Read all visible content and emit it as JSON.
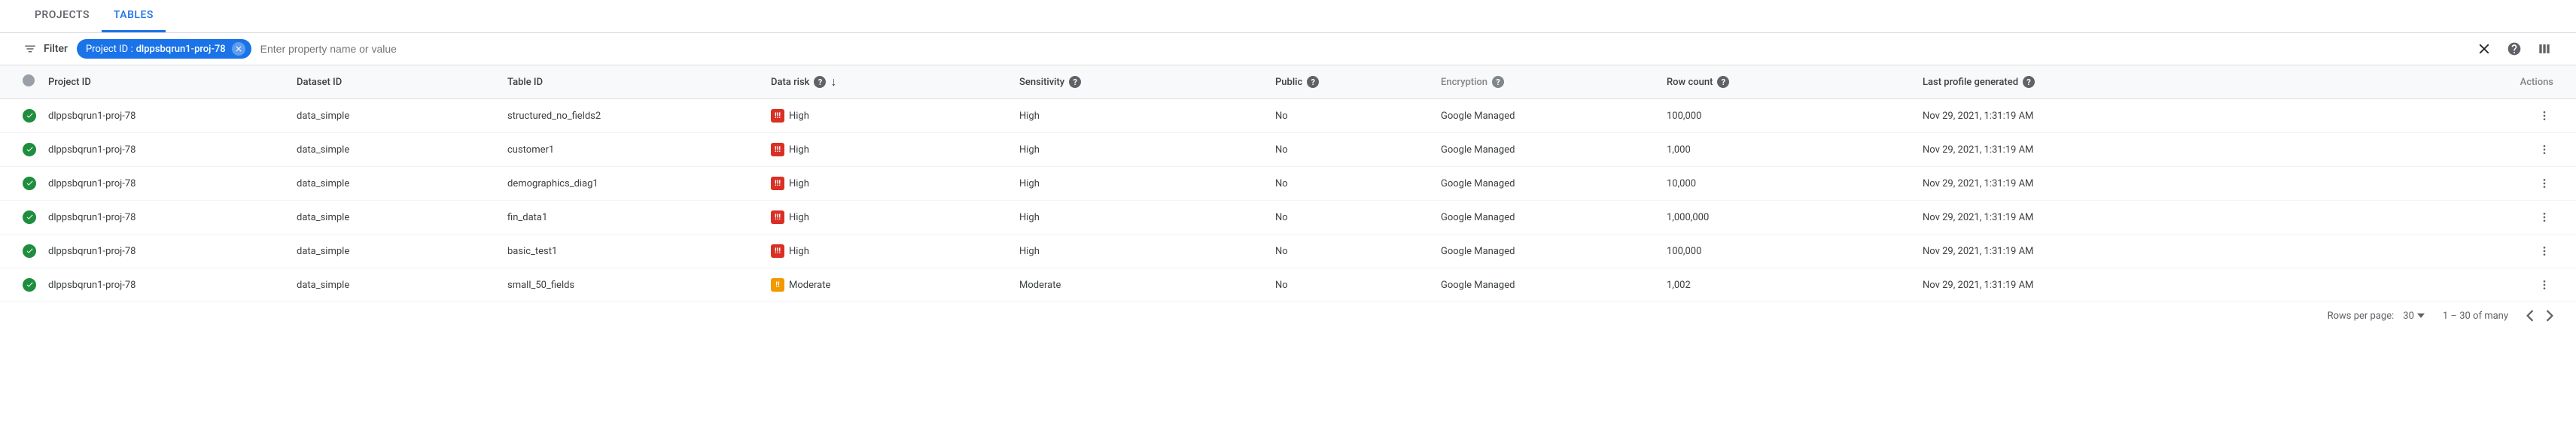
{
  "tabs": [
    {
      "label": "PROJECTS",
      "active": false
    },
    {
      "label": "TABLES",
      "active": true
    }
  ],
  "filter": {
    "label": "Filter",
    "chip_key": "Project ID :",
    "chip_value": "dlppsbqrun1-proj-78",
    "placeholder": "Enter property name or value"
  },
  "columns": {
    "project_id": "Project ID",
    "dataset_id": "Dataset ID",
    "table_id": "Table ID",
    "data_risk": "Data risk",
    "sensitivity": "Sensitivity",
    "public": "Public",
    "encryption": "Encryption",
    "row_count": "Row count",
    "last_generated": "Last profile generated",
    "actions": "Actions"
  },
  "rows": [
    {
      "project_id": "dlppsbqrun1-proj-78",
      "dataset_id": "data_simple",
      "table_id": "structured_no_fields2",
      "data_risk": "High",
      "risk_level": "high",
      "sensitivity": "High",
      "public": "No",
      "encryption": "Google Managed",
      "row_count": "100,000",
      "last_generated": "Nov 29, 2021, 1:31:19 AM"
    },
    {
      "project_id": "dlppsbqrun1-proj-78",
      "dataset_id": "data_simple",
      "table_id": "customer1",
      "data_risk": "High",
      "risk_level": "high",
      "sensitivity": "High",
      "public": "No",
      "encryption": "Google Managed",
      "row_count": "1,000",
      "last_generated": "Nov 29, 2021, 1:31:19 AM"
    },
    {
      "project_id": "dlppsbqrun1-proj-78",
      "dataset_id": "data_simple",
      "table_id": "demographics_diag1",
      "data_risk": "High",
      "risk_level": "high",
      "sensitivity": "High",
      "public": "No",
      "encryption": "Google Managed",
      "row_count": "10,000",
      "last_generated": "Nov 29, 2021, 1:31:19 AM"
    },
    {
      "project_id": "dlppsbqrun1-proj-78",
      "dataset_id": "data_simple",
      "table_id": "fin_data1",
      "data_risk": "High",
      "risk_level": "high",
      "sensitivity": "High",
      "public": "No",
      "encryption": "Google Managed",
      "row_count": "1,000,000",
      "last_generated": "Nov 29, 2021, 1:31:19 AM"
    },
    {
      "project_id": "dlppsbqrun1-proj-78",
      "dataset_id": "data_simple",
      "table_id": "basic_test1",
      "data_risk": "High",
      "risk_level": "high",
      "sensitivity": "High",
      "public": "No",
      "encryption": "Google Managed",
      "row_count": "100,000",
      "last_generated": "Nov 29, 2021, 1:31:19 AM"
    },
    {
      "project_id": "dlppsbqrun1-proj-78",
      "dataset_id": "data_simple",
      "table_id": "small_50_fields",
      "data_risk": "Moderate",
      "risk_level": "moderate",
      "sensitivity": "Moderate",
      "public": "No",
      "encryption": "Google Managed",
      "row_count": "1,002",
      "last_generated": "Nov 29, 2021, 1:31:19 AM"
    }
  ],
  "pagination": {
    "rows_per_page_label": "Rows per page:",
    "rows_per_page_value": "30",
    "range_text": "1 – 30 of many"
  }
}
